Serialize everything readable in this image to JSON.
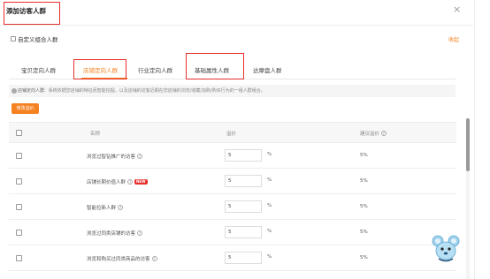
{
  "dialog": {
    "title": "添加访客人群",
    "close": "×"
  },
  "custom_crowd": {
    "label": "自定义组合人群",
    "collapse": "收起"
  },
  "tabs": [
    {
      "label": "宝贝定向人群"
    },
    {
      "label": "店铺定向人群"
    },
    {
      "label": "行业定向人群"
    },
    {
      "label": "基础属性人群"
    },
    {
      "label": "达摩盘人群"
    }
  ],
  "info": {
    "label": "店铺定向人群:",
    "text": "系统依据您店铺的特征而智能挖掘，以及店铺的访客近期在您店铺的浏览/收藏/加购/购买行为的一组人群组合。"
  },
  "bulk_button": "修改溢价",
  "table": {
    "headers": {
      "name": "名称",
      "premium": "溢价",
      "suggested": "建议溢价"
    },
    "rows": [
      {
        "name": "浏览过智钻推广的访客",
        "value": "5",
        "unit": "%",
        "suggested": "5%"
      },
      {
        "name": "店铺长期价值人群",
        "badge": "NEW",
        "value": "5",
        "unit": "%",
        "suggested": "5%"
      },
      {
        "name": "智能拉新人群",
        "value": "5",
        "unit": "%",
        "suggested": "5%"
      },
      {
        "name": "浏览过同类店铺的访客",
        "value": "5",
        "unit": "%",
        "suggested": "5%"
      },
      {
        "name": "浏览和购买过同类商品的访客",
        "value": "5",
        "unit": "%",
        "suggested": "5%"
      }
    ]
  },
  "colors": {
    "accent": "#f5811f",
    "highlight": "#e5302d"
  }
}
